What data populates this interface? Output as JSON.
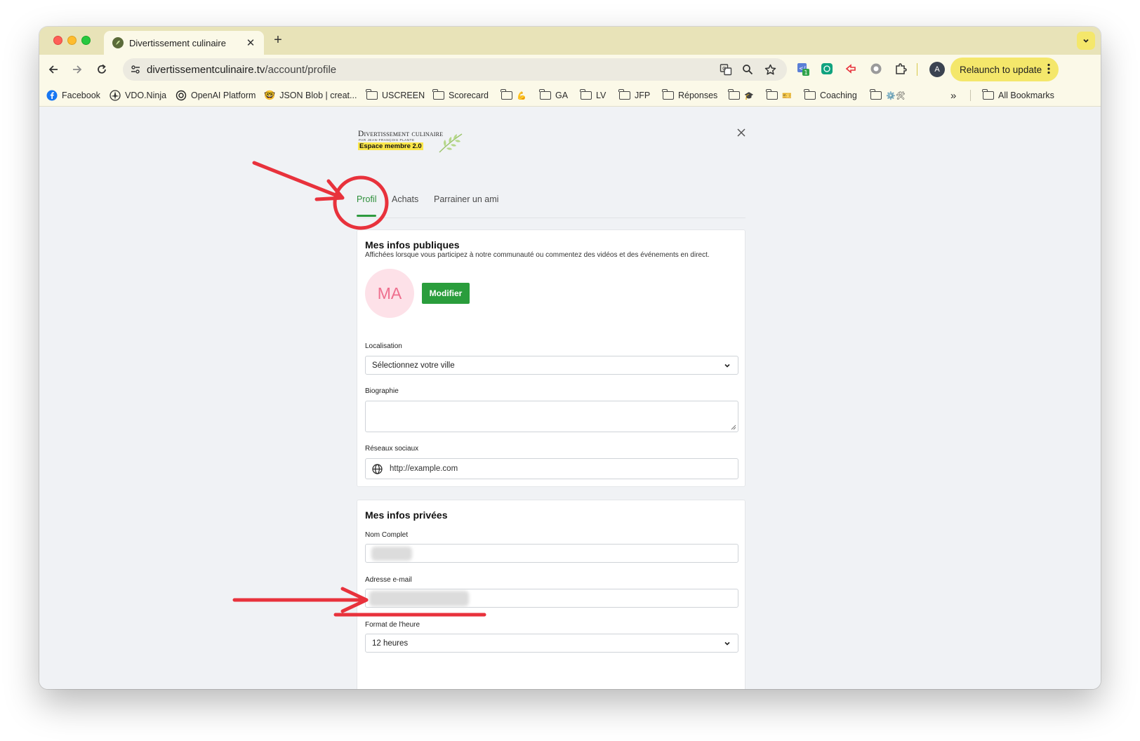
{
  "browser": {
    "tab_title": "Divertissement culinaire",
    "url_domain": "divertissementculinaire.tv",
    "url_path": "/account/profile",
    "relaunch_label": "Relaunch to update",
    "profile_initial": "A",
    "extension_badge": "1",
    "accent_color": "#f4e76b"
  },
  "bookmarks": [
    {
      "label": "Facebook",
      "icon": "facebook-icon"
    },
    {
      "label": "VDO.Ninja",
      "icon": "vdo-ninja-icon"
    },
    {
      "label": "OpenAI Platform",
      "icon": "openai-icon"
    },
    {
      "label": "JSON Blob | creat...",
      "icon": "nerd-face-icon"
    },
    {
      "label": "USCREEN",
      "icon": "folder-icon"
    },
    {
      "label": "Scorecard",
      "icon": "folder-icon"
    },
    {
      "label": "💪",
      "icon": "folder-icon"
    },
    {
      "label": "GA",
      "icon": "folder-icon"
    },
    {
      "label": "LV",
      "icon": "folder-icon"
    },
    {
      "label": "JFP",
      "icon": "folder-icon"
    },
    {
      "label": "Réponses",
      "icon": "folder-icon"
    },
    {
      "label": "🎓",
      "icon": "folder-icon"
    },
    {
      "label": "🎫",
      "icon": "folder-icon"
    },
    {
      "label": "Coaching",
      "icon": "folder-icon"
    },
    {
      "label": "⚙️🛠",
      "icon": "folder-icon"
    }
  ],
  "bookmarks_more": "»",
  "all_bookmarks": "All Bookmarks",
  "site": {
    "logo_line1": "Divertissement culinaire",
    "logo_line2": "PAR JEAN-FRANÇOIS PLANTE",
    "logo_line3": "Espace membre 2.0"
  },
  "tabs": [
    {
      "label": "Profil",
      "active": true
    },
    {
      "label": "Achats",
      "active": false
    },
    {
      "label": "Parrainer un ami",
      "active": false
    }
  ],
  "public_info": {
    "title": "Mes infos publiques",
    "subtitle": "Affichées lorsque vous participez à notre communauté ou commentez des vidéos et des événements en direct.",
    "avatar_initials": "MA",
    "edit_button": "Modifier",
    "location_label": "Localisation",
    "location_value": "Sélectionnez votre ville",
    "bio_label": "Biographie",
    "bio_value": "",
    "social_label": "Réseaux sociaux",
    "social_placeholder": "http://example.com"
  },
  "private_info": {
    "title": "Mes infos privées",
    "fullname_label": "Nom Complet",
    "email_label": "Adresse e-mail",
    "time_label": "Format de l'heure",
    "time_value": "12 heures"
  },
  "colors": {
    "brand_green": "#2a9d3c",
    "annotation_red": "#e8323c",
    "avatar_pink": "#fde1e8"
  }
}
